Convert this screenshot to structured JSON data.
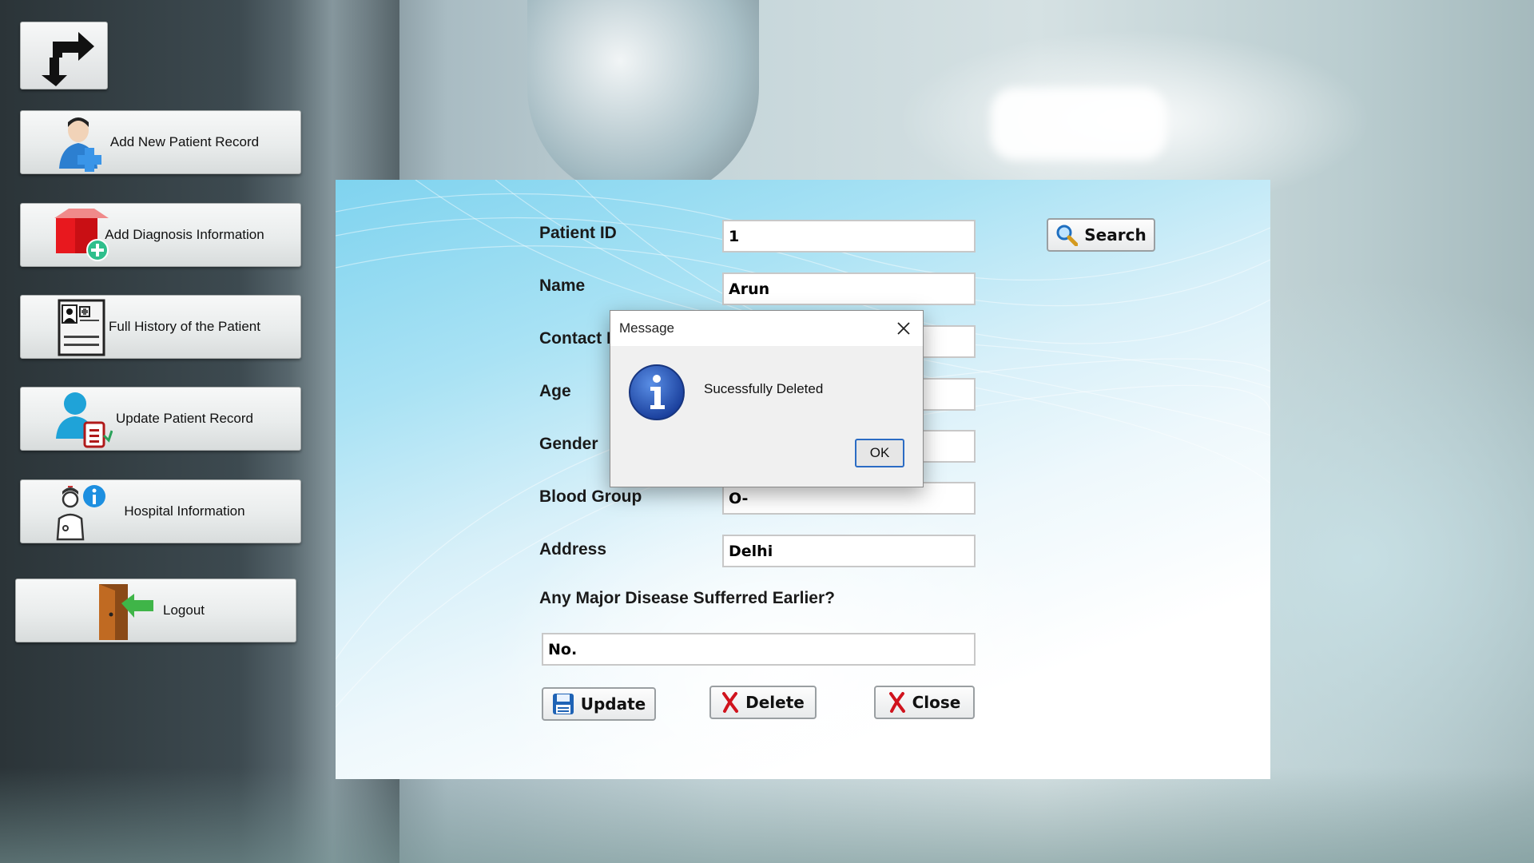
{
  "sidebar": {
    "items": [
      {
        "label": "Add New Patient Record",
        "icon": "add-patient-icon"
      },
      {
        "label": "Add Diagnosis Information",
        "icon": "diagnosis-icon"
      },
      {
        "label": "Full History of the Patient",
        "icon": "patient-history-icon"
      },
      {
        "label": "Update Patient Record",
        "icon": "update-patient-icon"
      },
      {
        "label": "Hospital Information",
        "icon": "hospital-info-icon"
      },
      {
        "label": "Logout",
        "icon": "logout-door-icon"
      }
    ],
    "back_icon": "back-arrow-icon"
  },
  "form": {
    "patient_id_label": "Patient ID",
    "patient_id_value": "1",
    "name_label": "Name",
    "name_value": "Arun",
    "contact_label": "Contact No",
    "contact_value": "",
    "age_label": "Age",
    "age_value": "",
    "gender_label": "Gender",
    "gender_value": "",
    "blood_group_label": "Blood Group",
    "blood_group_value": "O-",
    "address_label": "Address",
    "address_value": "Delhi",
    "disease_label": "Any Major Disease Sufferred Earlier?",
    "disease_value": "No."
  },
  "buttons": {
    "search": "Search",
    "update": "Update",
    "delete": "Delete",
    "close": "Close"
  },
  "dialog": {
    "title": "Message",
    "message": "Sucessfully Deleted",
    "ok": "OK",
    "icon": "info-icon"
  },
  "colors": {
    "accent_blue": "#2b6cc4",
    "delete_red": "#d0131d",
    "panel_blue": "#7fd3ef"
  }
}
